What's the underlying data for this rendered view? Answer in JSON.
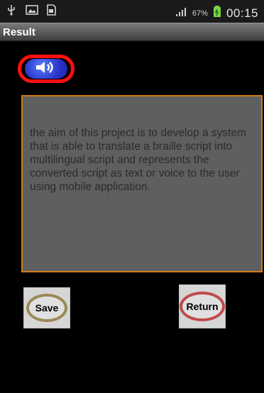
{
  "status_bar": {
    "left_icons": [
      "usb-icon",
      "image-icon",
      "sim-icon"
    ],
    "battery_percent": "67%",
    "time": "00:15"
  },
  "title_bar": {
    "title": "Result"
  },
  "speaker": {
    "icon": "speaker-icon"
  },
  "result_text": "the aim of this project is to develop a system that is able to translate a braille script into multilingual script and represents the converted script as text or voice to the user using mobile application.",
  "buttons": {
    "save_label": "Save",
    "return_label": "Return"
  },
  "colors": {
    "speaker_ring": "#ff1010",
    "speaker_fill": "#2a35c8",
    "panel_border": "#d27a1b",
    "panel_bg": "#5f5f5f",
    "save_ring": "#9a8a57",
    "return_ring": "#c04a4a"
  }
}
